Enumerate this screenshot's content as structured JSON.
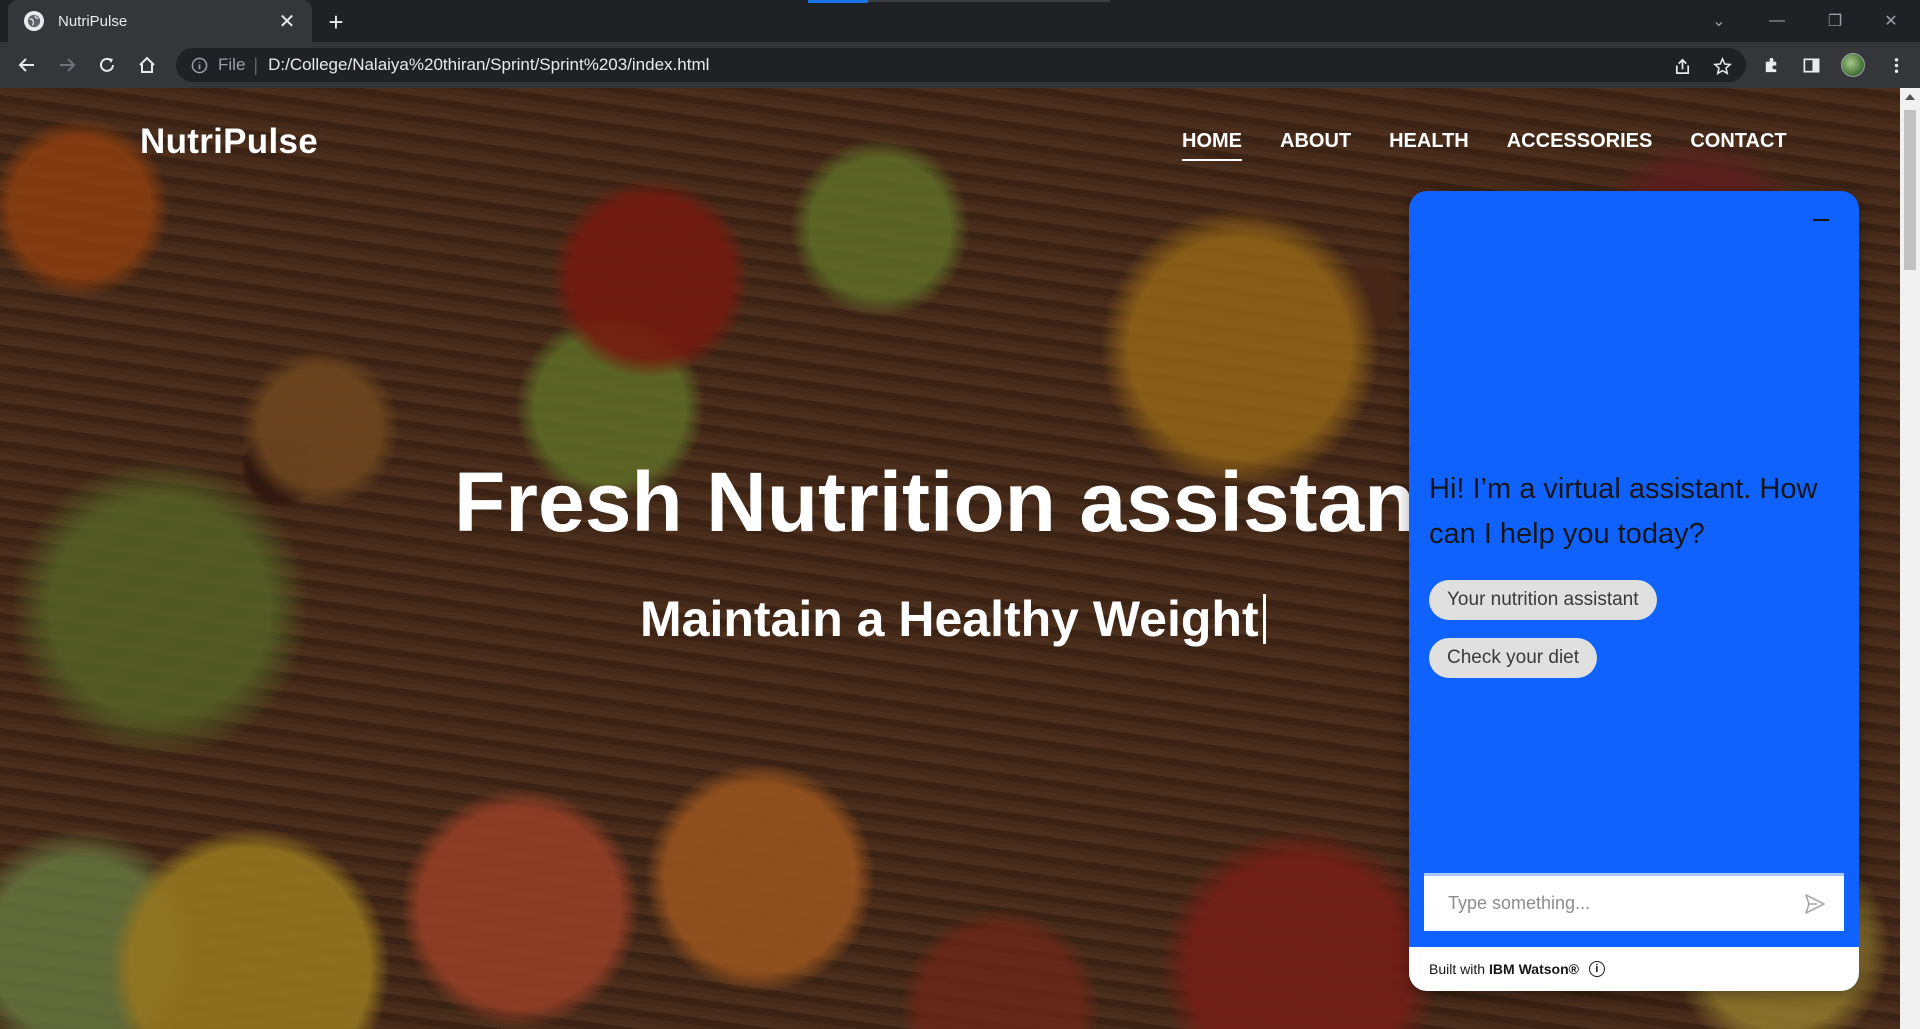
{
  "browser": {
    "tab_title": "NutriPulse",
    "omnibox_scheme": "File",
    "omnibox_url": "D:/College/Nalaiya%20thiran/Sprint/Sprint%203/index.html"
  },
  "page": {
    "brand": "NutriPulse",
    "nav": [
      "HOME",
      "ABOUT",
      "HEALTH",
      "ACCESSORIES",
      "CONTACT"
    ],
    "active_nav": "HOME",
    "hero_title": "Fresh Nutrition assistan",
    "hero_subtitle": "Maintain a Healthy Weight"
  },
  "chat": {
    "greeting": "Hi! I’m a virtual assistant. How can I help you today?",
    "options": [
      "Your nutrition assistant",
      "Check your diet"
    ],
    "input_placeholder": "Type something...",
    "footer_prefix": "Built with",
    "footer_brand": "IBM Watson®",
    "accent": "#0f62fe"
  }
}
